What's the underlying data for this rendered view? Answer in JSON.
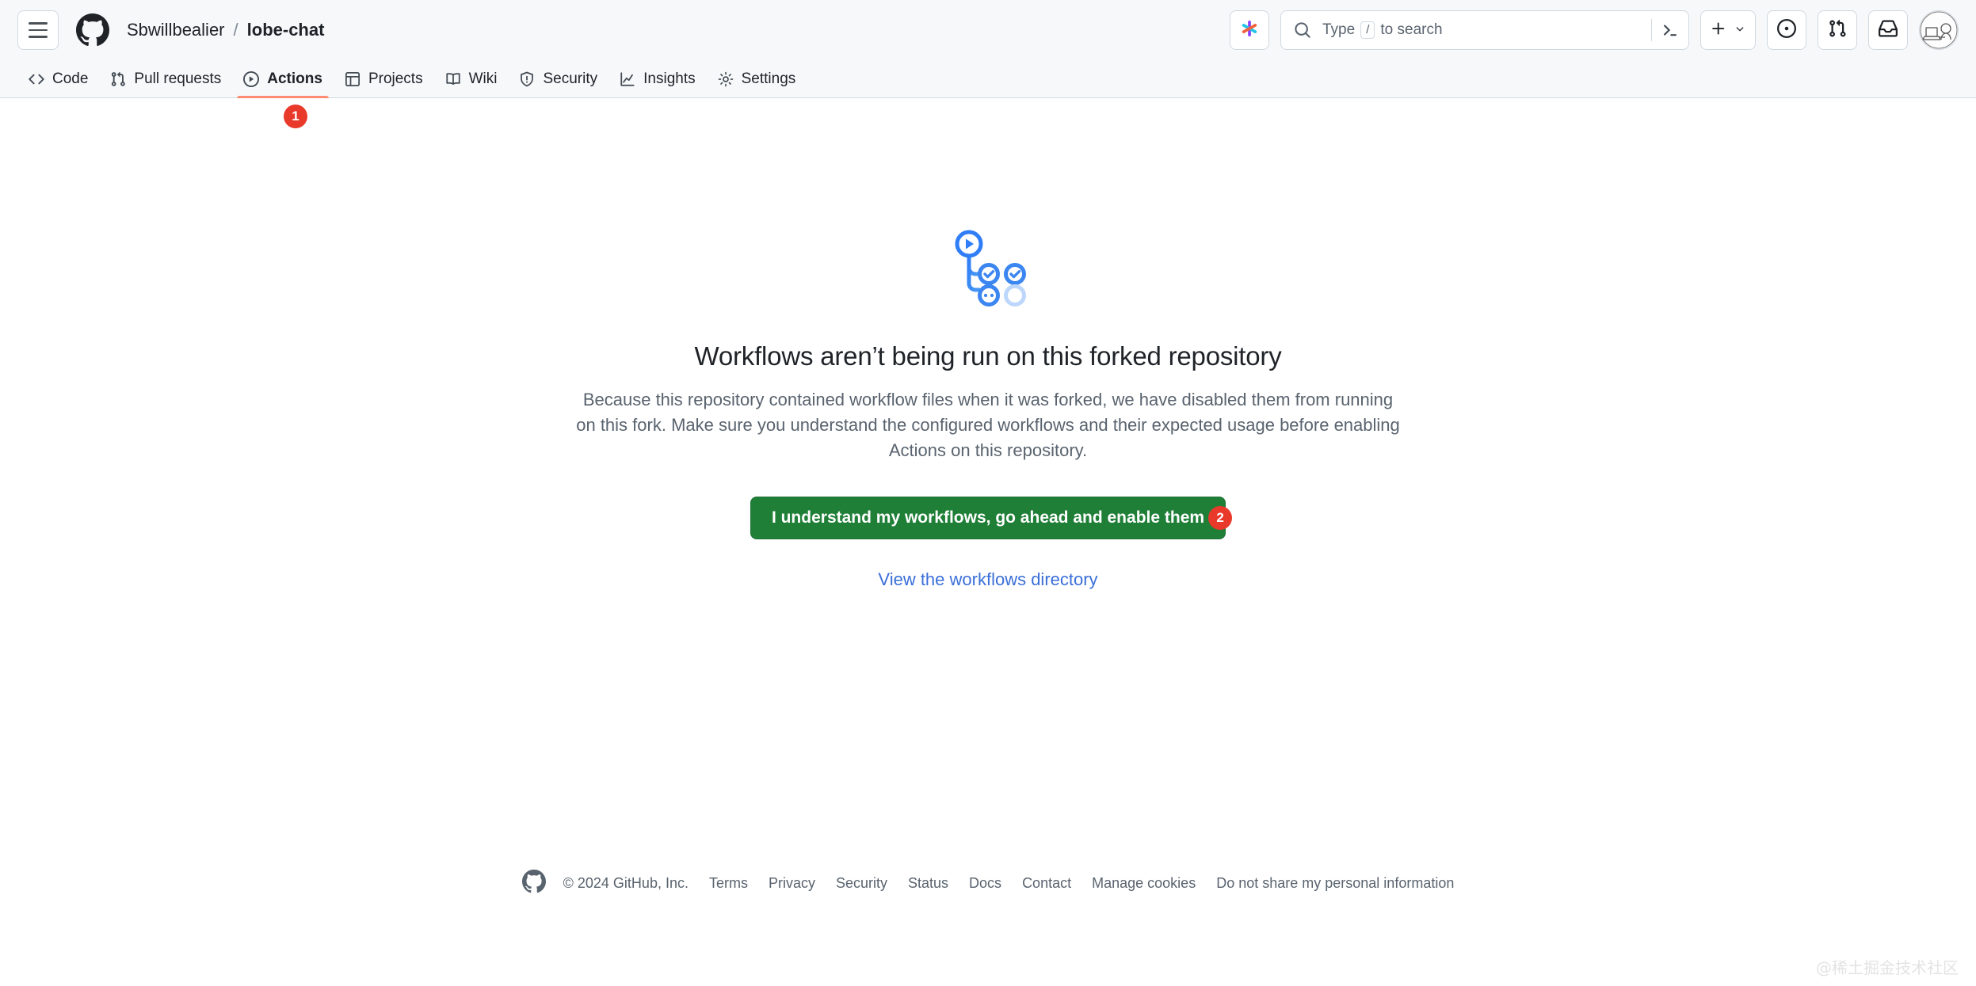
{
  "header": {
    "menu_icon": "hamburger-icon",
    "logo_icon": "github-logo-icon",
    "breadcrumb": {
      "owner": "Sbwillbealier",
      "separator": "/",
      "repo": "lobe-chat"
    },
    "copilot_icon": "copilot-sparkle-icon",
    "search": {
      "icon": "search-icon",
      "placeholder_prefix": "Type",
      "placeholder_key": "/",
      "placeholder_suffix": "to search",
      "terminal_icon": "terminal-prompt-icon"
    },
    "create_new": {
      "icon": "plus-icon",
      "chevron": "chevron-down-icon"
    },
    "issues_icon": "issues-circle-icon",
    "pull_requests_icon": "git-pull-request-icon",
    "inbox_icon": "inbox-icon",
    "avatar_icon": "user-avatar"
  },
  "nav": {
    "tabs": [
      {
        "label": "Code",
        "icon": "code-icon",
        "active": false
      },
      {
        "label": "Pull requests",
        "icon": "git-pull-request-icon",
        "active": false
      },
      {
        "label": "Actions",
        "icon": "play-circle-icon",
        "active": true
      },
      {
        "label": "Projects",
        "icon": "table-icon",
        "active": false
      },
      {
        "label": "Wiki",
        "icon": "book-icon",
        "active": false
      },
      {
        "label": "Security",
        "icon": "shield-icon",
        "active": false
      },
      {
        "label": "Insights",
        "icon": "graph-icon",
        "active": false
      },
      {
        "label": "Settings",
        "icon": "gear-icon",
        "active": false
      }
    ]
  },
  "annotations": {
    "nav_marker": "1",
    "button_marker": "2",
    "marker_color": "#e8392b"
  },
  "main": {
    "illustration": "workflow-graph-illustration",
    "heading": "Workflows aren’t being run on this forked repository",
    "description": "Because this repository contained workflow files when it was forked, we have disabled them from running on this fork. Make sure you understand the configured workflows and their expected usage before enabling Actions on this repository.",
    "enable_button_label": "I understand my workflows, go ahead and enable them",
    "enable_button_color": "#1f7f37",
    "view_link_label": "View the workflows directory",
    "link_color": "#3a6fd8"
  },
  "footer": {
    "logo_icon": "github-mark-icon",
    "copyright": "© 2024 GitHub, Inc.",
    "links": [
      "Terms",
      "Privacy",
      "Security",
      "Status",
      "Docs",
      "Contact",
      "Manage cookies",
      "Do not share my personal information"
    ]
  },
  "watermark": "@稀土掘金技术社区"
}
